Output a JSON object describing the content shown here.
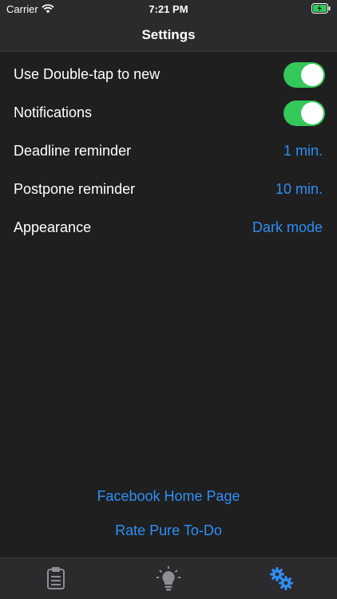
{
  "status_bar": {
    "carrier": "Carrier",
    "time": "7:21 PM",
    "wifi_icon": "wifi-icon",
    "battery_icon": "battery-charging-icon"
  },
  "nav": {
    "title": "Settings"
  },
  "settings": {
    "double_tap": {
      "label": "Use Double-tap to new",
      "toggle_on": true
    },
    "notifications": {
      "label": "Notifications",
      "toggle_on": true
    },
    "deadline": {
      "label": "Deadline reminder",
      "value": "1 min."
    },
    "postpone": {
      "label": "Postpone reminder",
      "value": "10 min."
    },
    "appearance": {
      "label": "Appearance",
      "value": "Dark mode"
    }
  },
  "links": {
    "facebook": "Facebook Home Page",
    "rate": "Rate Pure To-Do"
  },
  "tabs": [
    {
      "icon": "clipboard-icon",
      "active": false
    },
    {
      "icon": "lightbulb-icon",
      "active": false
    },
    {
      "icon": "gears-icon",
      "active": true
    }
  ],
  "colors": {
    "background": "#1f1f20",
    "bar": "#2b2b2d",
    "accent": "#2f8ff3",
    "toggle_on": "#34c759",
    "inactive_icon": "#8e8e93"
  }
}
